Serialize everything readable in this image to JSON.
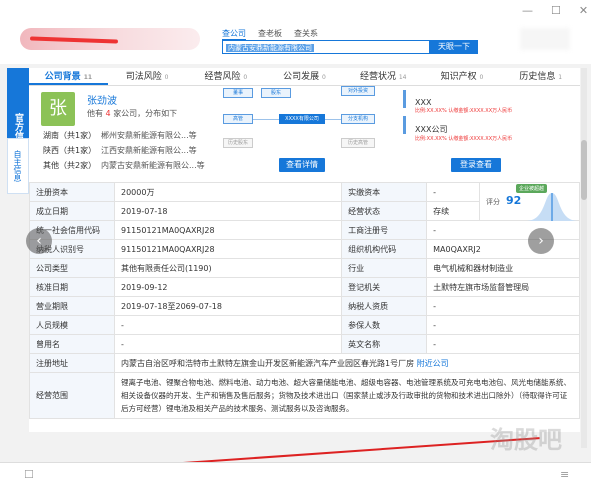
{
  "header": {
    "search_tabs": [
      "查公司",
      "查老板",
      "查关系"
    ],
    "search_value": "内蒙古安鼎新能源有限公司",
    "search_button": "天眼一下",
    "top_icons": [
      "minimize-icon",
      "maximize-icon",
      "close-icon"
    ]
  },
  "side_tabs": {
    "official": "官方信息",
    "self": "自主信息"
  },
  "nav": [
    {
      "label": "公司背景",
      "count": "11"
    },
    {
      "label": "司法风险",
      "count": "0"
    },
    {
      "label": "经营风险",
      "count": "0"
    },
    {
      "label": "公司发展",
      "count": "0"
    },
    {
      "label": "经营状况",
      "count": "14"
    },
    {
      "label": "知识产权",
      "count": "0"
    },
    {
      "label": "历史信息",
      "count": "1"
    }
  ],
  "person": {
    "avatar": "张",
    "name": "张劲波",
    "sub_prefix": "他有",
    "sub_count": "4",
    "sub_suffix": "家公司，分布如下",
    "regions": [
      {
        "region": "湖南（共1家）",
        "company": "郴州安鼎新能源有限公...等"
      },
      {
        "region": "陕西（共1家）",
        "company": "江西安鼎新能源有限公...等"
      },
      {
        "region": "其他（共2家）",
        "company": "内蒙古安鼎新能源有限公...等"
      }
    ]
  },
  "diagram": {
    "center": "XXXX有限公司",
    "nodes": [
      "董事",
      "高管",
      "股东",
      "对外投资",
      "分支机构",
      "历史股东",
      "历史高管"
    ],
    "button": "查看详情"
  },
  "share": {
    "line1": "XXX",
    "line1_sub": "比例:XX.XX% 认缴金额:XXXX.XX万人民币",
    "line2": "XXX公司",
    "line2_sub": "比例:XX.XX% 认缴金额:XXXX.XX万人民币",
    "button": "登录查看"
  },
  "score": {
    "tag": "企业被超越",
    "label": "评分",
    "value": "92"
  },
  "info_rows": [
    [
      "注册资本",
      "20000万",
      "实缴资本",
      "-"
    ],
    [
      "成立日期",
      "2019-07-18",
      "经营状态",
      "存续"
    ],
    [
      "统一社会信用代码",
      "91150121MA0QAXRJ28",
      "工商注册号",
      "-"
    ],
    [
      "纳税人识别号",
      "91150121MA0QAXRJ28",
      "组织机构代码",
      "MA0QAXRJ2"
    ],
    [
      "公司类型",
      "其他有限责任公司(1190)",
      "行业",
      "电气机械和器材制造业"
    ],
    [
      "核准日期",
      "2019-09-12",
      "登记机关",
      "土默特左旗市场监督管理局"
    ],
    [
      "营业期限",
      "2019-07-18至2069-07-18",
      "纳税人资质",
      "-"
    ],
    [
      "人员规模",
      "-",
      "参保人数",
      "-"
    ],
    [
      "曾用名",
      "-",
      "英文名称",
      "-"
    ]
  ],
  "address": {
    "label": "注册地址",
    "value": "内蒙古自治区呼和浩特市土默特左旗金山开发区新能源汽车产业园区春光路1号厂房",
    "link": "附近公司"
  },
  "scope": {
    "label": "经营范围",
    "value": "锂离子电池、锂聚合物电池、燃料电池、动力电池、超大容量储能电池、超级电容器、电池管理系统及可充电电池包、风光电储能系统、相关设备仪器的开发、生产和销售及售后服务；货物及技术进出口（国家禁止或涉及行政审批的货物和技术进出口除外）（待取得许可证后方可经营）锂电池及相关产品的技术服务、测试服务以及咨询服务。"
  },
  "watermark": "淘股吧"
}
